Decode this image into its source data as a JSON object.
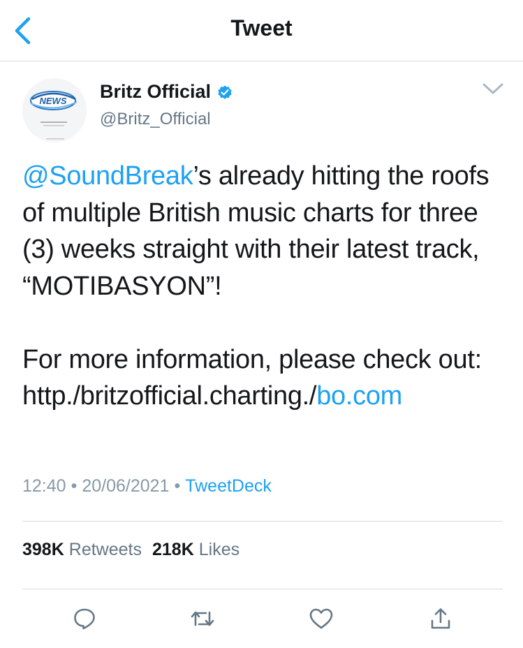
{
  "header": {
    "title": "Tweet",
    "back_icon": "chevron-left-icon"
  },
  "author": {
    "name": "Britz Official",
    "handle": "@Britz_Official",
    "verified": true,
    "avatar_logo_text": "NEWS"
  },
  "tweet": {
    "mention": "@SoundBreak",
    "text_part1": "’s already hitting the roofs of multiple British music charts for three (3) weeks straight with their latest track, “MOTIBASYON”!\n\nFor more information, please check out: http./britzofficial.charting./",
    "link_text": "bo.com"
  },
  "meta": {
    "time": "12:40",
    "separator": "•",
    "date": "20/06/2021",
    "source": "TweetDeck"
  },
  "stats": {
    "retweets_count": "398K",
    "retweets_label": "Retweets",
    "likes_count": "218K",
    "likes_label": "Likes"
  },
  "actions": [
    "reply-icon",
    "retweet-icon",
    "like-icon",
    "share-icon"
  ],
  "colors": {
    "accent": "#1da1f2",
    "text": "#14171a",
    "secondary": "#657786",
    "divider": "#d9d9d9"
  }
}
